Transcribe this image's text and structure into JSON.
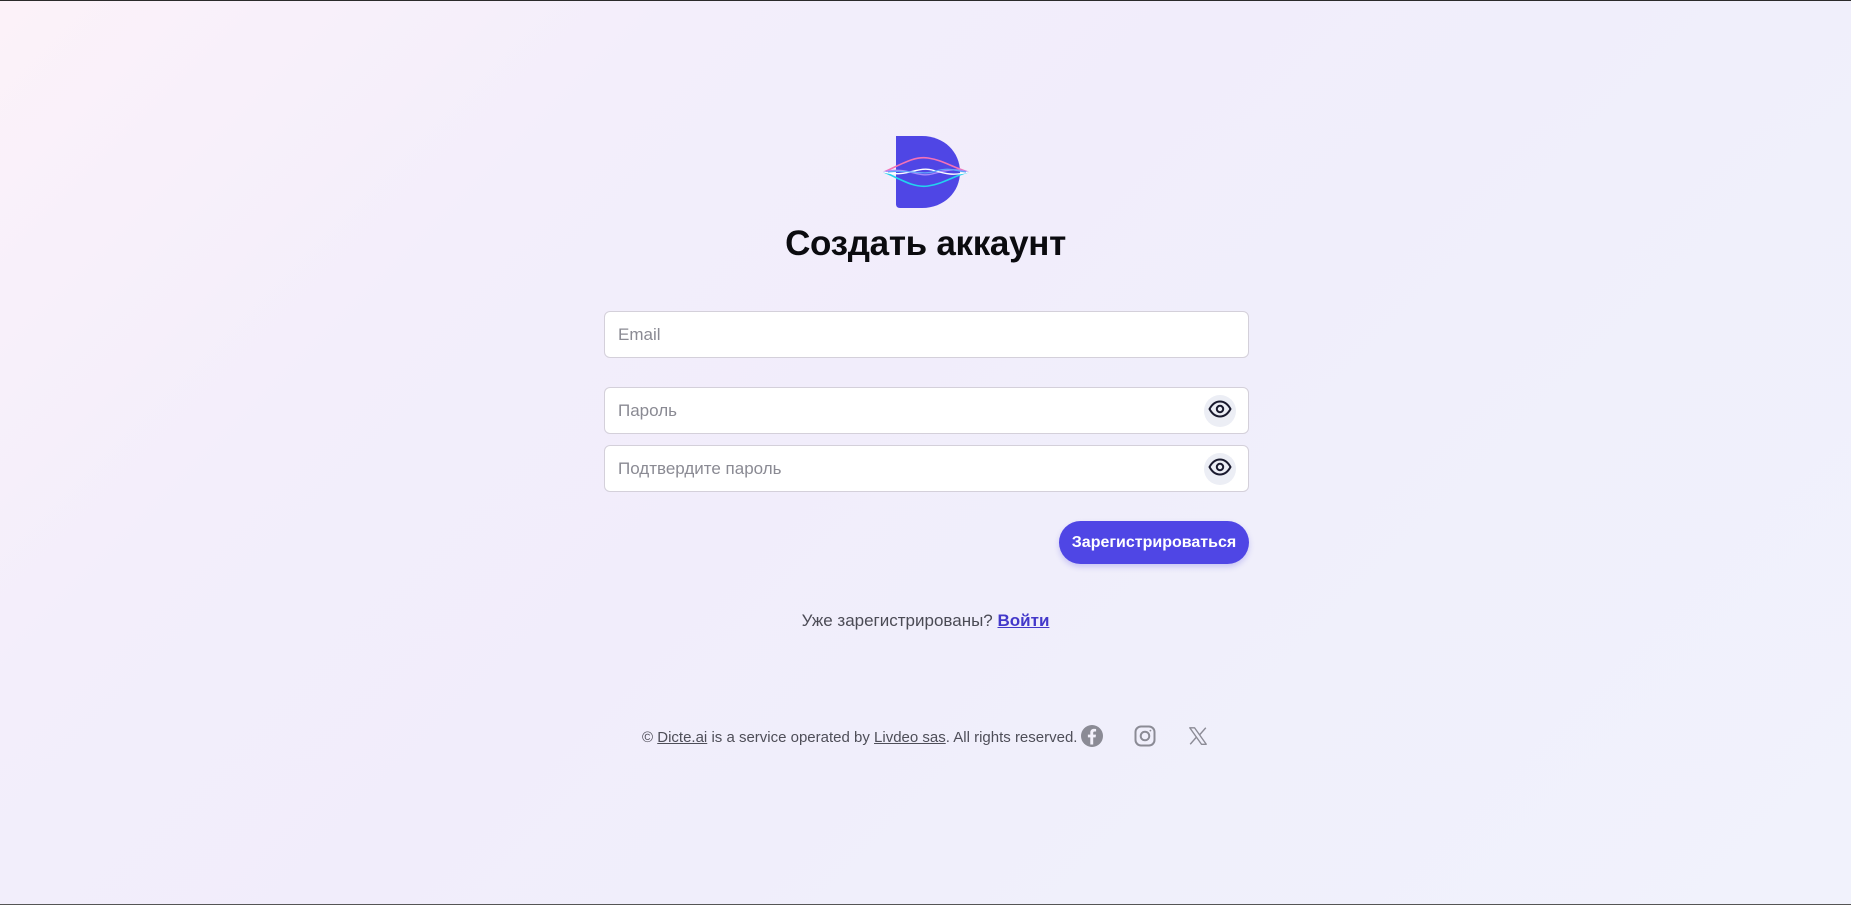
{
  "page": {
    "title": "Создать аккаунт"
  },
  "form": {
    "email_placeholder": "Email",
    "password_placeholder": "Пароль",
    "confirm_placeholder": "Подтвердите пароль",
    "submit_label": "Зарегистрироваться"
  },
  "signin": {
    "prompt": "Уже зарегистрированы?",
    "link_label": "Войти"
  },
  "footer": {
    "copyright_symbol": "©",
    "brand_link": "Dicte.ai",
    "middle_text": "is a service operated by",
    "company_link": "Livdeo sas",
    "rights_text": ". All rights reserved."
  },
  "social": {
    "icons": [
      "facebook-icon",
      "instagram-icon",
      "x-icon"
    ]
  },
  "colors": {
    "accent": "#4f46e5",
    "link": "#4338ca",
    "icon_gray": "#8b8b95"
  }
}
